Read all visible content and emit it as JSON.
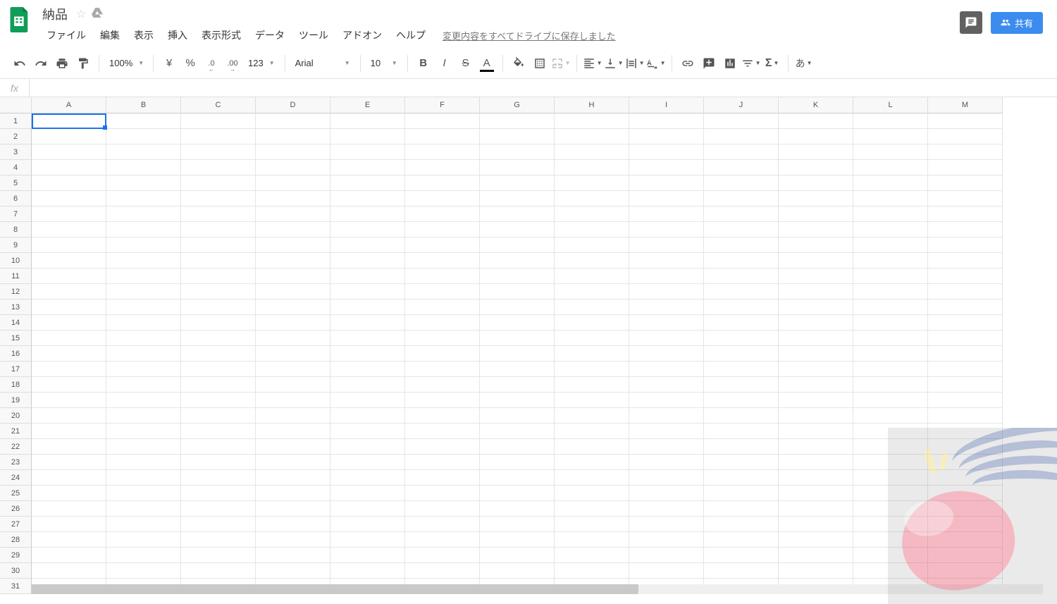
{
  "doc": {
    "title": "納品"
  },
  "menu": {
    "file": "ファイル",
    "edit": "編集",
    "view": "表示",
    "insert": "挿入",
    "format": "表示形式",
    "data": "データ",
    "tools": "ツール",
    "addons": "アドオン",
    "help": "ヘルプ",
    "save_status": "変更内容をすべてドライブに保存しました"
  },
  "share": {
    "label": "共有"
  },
  "toolbar": {
    "zoom": "100%",
    "currency": "¥",
    "percent": "%",
    "dec_dec": ".0",
    "inc_dec": ".00",
    "more_fmt": "123",
    "font": "Arial",
    "size": "10"
  },
  "formula": {
    "fx": "fx",
    "value": ""
  },
  "columns": [
    "A",
    "B",
    "C",
    "D",
    "E",
    "F",
    "G",
    "H",
    "I",
    "J",
    "K",
    "L",
    "M"
  ],
  "rows": [
    "1",
    "2",
    "3",
    "4",
    "5",
    "6",
    "7",
    "8",
    "9",
    "10",
    "11",
    "12",
    "13",
    "14",
    "15",
    "16",
    "17",
    "18",
    "19",
    "20",
    "21",
    "22",
    "23",
    "24",
    "25",
    "26",
    "27",
    "28",
    "29",
    "30",
    "31"
  ],
  "selected": {
    "row": 0,
    "col": 0
  }
}
